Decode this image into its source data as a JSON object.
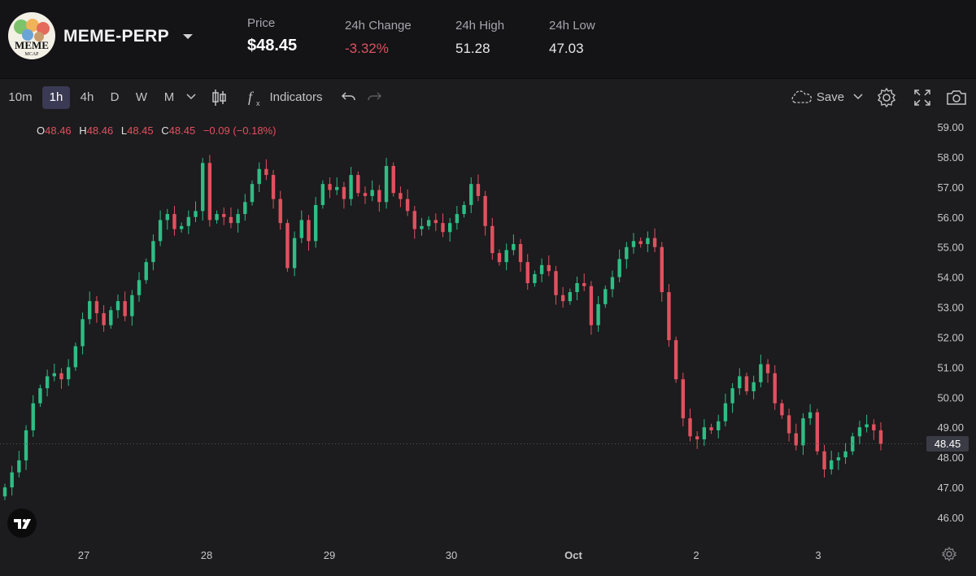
{
  "header": {
    "symbol": "MEME-PERP",
    "logo_text": "MEME",
    "logo_subtext": "MCAP",
    "price_label": "Price",
    "price_value": "$48.45",
    "change_label": "24h Change",
    "change_value": "-3.32%",
    "high_label": "24h High",
    "high_value": "51.28",
    "low_label": "24h Low",
    "low_value": "47.03"
  },
  "toolbar": {
    "intervals": [
      "10m",
      "1h",
      "4h",
      "D",
      "W",
      "M"
    ],
    "active_interval": "1h",
    "indicators_label": "Indicators",
    "save_label": "Save"
  },
  "ohlc": {
    "o_key": "O",
    "o_val": "48.46",
    "h_key": "H",
    "h_val": "48.46",
    "l_key": "L",
    "l_val": "48.45",
    "c_key": "C",
    "c_val": "48.45",
    "change": "−0.09 (−0.18%)"
  },
  "colors": {
    "up": "#2ebd85",
    "down": "#e0515f",
    "background": "#1c1b1d",
    "header_bg": "#141316"
  },
  "chart_data": {
    "type": "candlestick",
    "last_price": "48.45",
    "y_ticks": [
      "59.00",
      "58.00",
      "57.00",
      "56.00",
      "55.00",
      "54.00",
      "53.00",
      "52.00",
      "51.00",
      "50.00",
      "49.00",
      "48.00",
      "47.00",
      "46.00"
    ],
    "x_ticks": [
      "27",
      "28",
      "29",
      "30",
      "Oct",
      "2",
      "3"
    ],
    "ylim": [
      45.6,
      59.3
    ],
    "close_series": [
      47.0,
      47.5,
      47.9,
      48.9,
      49.8,
      50.3,
      50.7,
      50.8,
      50.6,
      51.0,
      51.7,
      52.6,
      53.2,
      52.8,
      52.4,
      52.9,
      53.2,
      52.7,
      53.4,
      53.9,
      54.5,
      55.2,
      55.9,
      56.1,
      55.6,
      55.7,
      56.0,
      56.2,
      57.8,
      55.9,
      56.1,
      56.0,
      55.8,
      56.1,
      56.5,
      57.1,
      57.6,
      57.4,
      56.6,
      55.8,
      54.3,
      55.3,
      55.9,
      55.2,
      56.4,
      57.1,
      56.9,
      57.0,
      56.6,
      57.4,
      56.8,
      56.7,
      56.9,
      56.5,
      57.7,
      56.8,
      56.6,
      56.2,
      55.6,
      55.7,
      55.9,
      55.8,
      55.5,
      55.8,
      56.1,
      56.4,
      57.1,
      56.7,
      55.7,
      54.8,
      54.5,
      54.9,
      55.1,
      54.5,
      53.8,
      54.1,
      54.4,
      54.2,
      53.4,
      53.2,
      53.5,
      53.8,
      53.7,
      52.4,
      53.1,
      53.6,
      54.0,
      54.6,
      55.0,
      55.2,
      55.1,
      55.3,
      55.0,
      53.5,
      51.9,
      50.6,
      49.3,
      48.7,
      48.6,
      49.0,
      48.9,
      49.2,
      49.8,
      50.3,
      50.7,
      50.2,
      50.5,
      51.1,
      50.8,
      49.8,
      49.4,
      48.8,
      48.4,
      49.3,
      49.5,
      48.2,
      47.6,
      47.9,
      48.0,
      48.2,
      48.7,
      49.0,
      49.1,
      48.9,
      48.45
    ]
  }
}
